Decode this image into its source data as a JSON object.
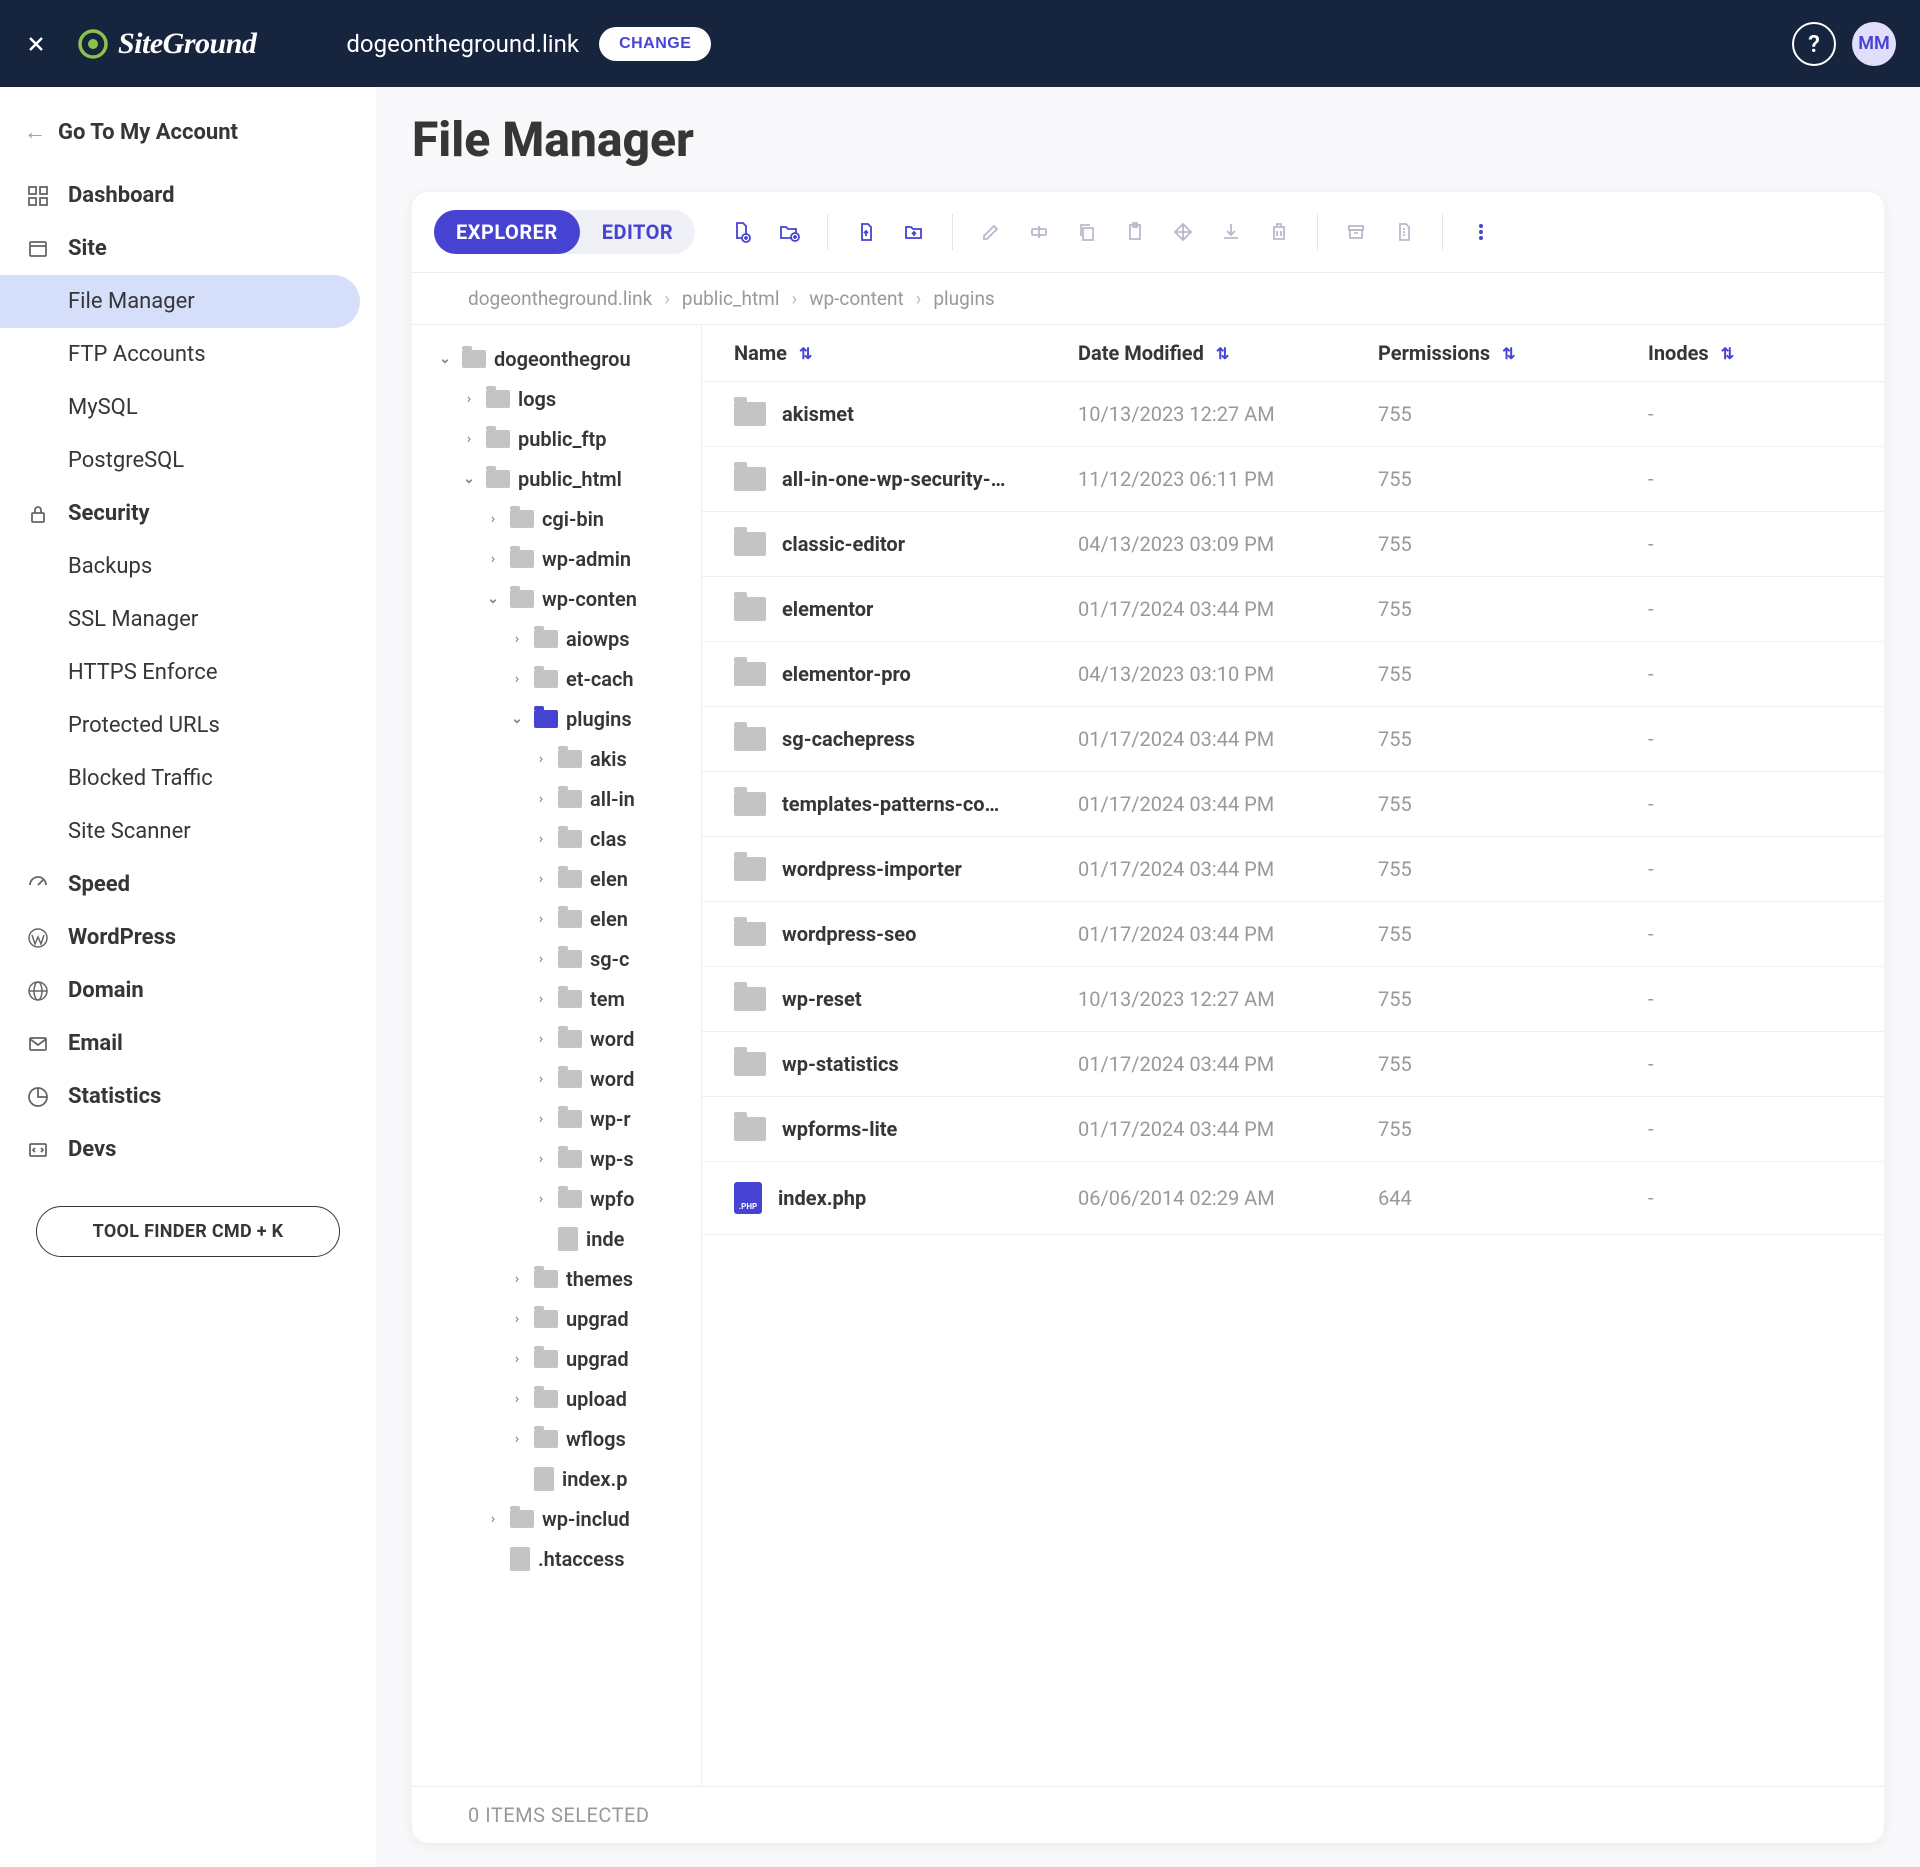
{
  "topbar": {
    "logo_text": "SiteGround",
    "domain": "dogeontheground.link",
    "change_label": "CHANGE",
    "help_label": "?",
    "avatar_initials": "MM"
  },
  "sidebar": {
    "go_back": "Go To My Account",
    "sections": {
      "dashboard": "Dashboard",
      "site": "Site",
      "security": "Security",
      "speed": "Speed",
      "wordpress": "WordPress",
      "domain": "Domain",
      "email": "Email",
      "statistics": "Statistics",
      "devs": "Devs"
    },
    "site_items": {
      "file_manager": "File Manager",
      "ftp_accounts": "FTP Accounts",
      "mysql": "MySQL",
      "postgresql": "PostgreSQL"
    },
    "security_items": {
      "backups": "Backups",
      "ssl_manager": "SSL Manager",
      "https_enforce": "HTTPS Enforce",
      "protected_urls": "Protected URLs",
      "blocked_traffic": "Blocked Traffic",
      "site_scanner": "Site Scanner"
    },
    "tool_finder": "TOOL FINDER CMD + K"
  },
  "page": {
    "title": "File Manager"
  },
  "tabs": {
    "explorer": "EXPLORER",
    "editor": "EDITOR"
  },
  "breadcrumb": {
    "c0": "dogeontheground.link",
    "c1": "public_html",
    "c2": "wp-content",
    "c3": "plugins"
  },
  "tree": {
    "root": "dogeonthegrou",
    "logs": "logs",
    "public_ftp": "public_ftp",
    "public_html": "public_html",
    "cgi_bin": "cgi-bin",
    "wp_admin": "wp-admin",
    "wp_content": "wp-conten",
    "aiowps": "aiowps",
    "et_cache": "et-cach",
    "plugins": "plugins",
    "akismet": "akis",
    "all_in": "all-in",
    "classic": "clas",
    "elem1": "elen",
    "elem2": "elen",
    "sgc": "sg-c",
    "temp": "tem",
    "word1": "word",
    "word2": "word",
    "wpr": "wp-r",
    "wps": "wp-s",
    "wpf": "wpfo",
    "index": "inde",
    "themes": "themes",
    "upgrad1": "upgrad",
    "upgrad2": "upgrad",
    "upload": "upload",
    "wflogs": "wflogs",
    "index_p": "index.p",
    "wp_includ": "wp-includ",
    "htaccess": ".htaccess"
  },
  "table": {
    "headers": {
      "name": "Name",
      "date": "Date Modified",
      "perm": "Permissions",
      "inode": "Inodes"
    },
    "rows": [
      {
        "name": "akismet",
        "date": "10/13/2023 12:27 AM",
        "perm": "755",
        "inode": "-",
        "type": "folder"
      },
      {
        "name": "all-in-one-wp-security-…",
        "date": "11/12/2023 06:11 PM",
        "perm": "755",
        "inode": "-",
        "type": "folder"
      },
      {
        "name": "classic-editor",
        "date": "04/13/2023 03:09 PM",
        "perm": "755",
        "inode": "-",
        "type": "folder"
      },
      {
        "name": "elementor",
        "date": "01/17/2024 03:44 PM",
        "perm": "755",
        "inode": "-",
        "type": "folder"
      },
      {
        "name": "elementor-pro",
        "date": "04/13/2023 03:10 PM",
        "perm": "755",
        "inode": "-",
        "type": "folder"
      },
      {
        "name": "sg-cachepress",
        "date": "01/17/2024 03:44 PM",
        "perm": "755",
        "inode": "-",
        "type": "folder"
      },
      {
        "name": "templates-patterns-co…",
        "date": "01/17/2024 03:44 PM",
        "perm": "755",
        "inode": "-",
        "type": "folder"
      },
      {
        "name": "wordpress-importer",
        "date": "01/17/2024 03:44 PM",
        "perm": "755",
        "inode": "-",
        "type": "folder"
      },
      {
        "name": "wordpress-seo",
        "date": "01/17/2024 03:44 PM",
        "perm": "755",
        "inode": "-",
        "type": "folder"
      },
      {
        "name": "wp-reset",
        "date": "10/13/2023 12:27 AM",
        "perm": "755",
        "inode": "-",
        "type": "folder"
      },
      {
        "name": "wp-statistics",
        "date": "01/17/2024 03:44 PM",
        "perm": "755",
        "inode": "-",
        "type": "folder"
      },
      {
        "name": "wpforms-lite",
        "date": "01/17/2024 03:44 PM",
        "perm": "755",
        "inode": "-",
        "type": "folder"
      },
      {
        "name": "index.php",
        "date": "06/06/2014 02:29 AM",
        "perm": "644",
        "inode": "-",
        "type": "php"
      }
    ],
    "php_label": ".PHP"
  },
  "status": "0 ITEMS SELECTED"
}
